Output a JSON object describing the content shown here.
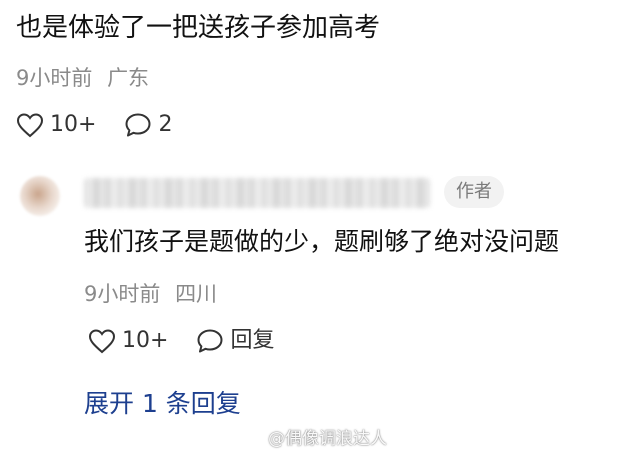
{
  "post": {
    "text": "也是体验了一把送孩子参加高考",
    "time": "9小时前",
    "location": "广东",
    "likes": "10+",
    "comments": "2"
  },
  "reply": {
    "author_badge": "作者",
    "text": "我们孩子是题做的少，题刷够了绝对没问题",
    "time": "9小时前",
    "location": "四川",
    "likes": "10+",
    "reply_label": "回复"
  },
  "expand": {
    "label": "展开 1 条回复"
  },
  "watermark": {
    "text": "@偶像调浪达人"
  },
  "colors": {
    "link": "#1d3f8f",
    "meta": "#8a8a8a",
    "badge_bg": "#f2f2f2"
  }
}
